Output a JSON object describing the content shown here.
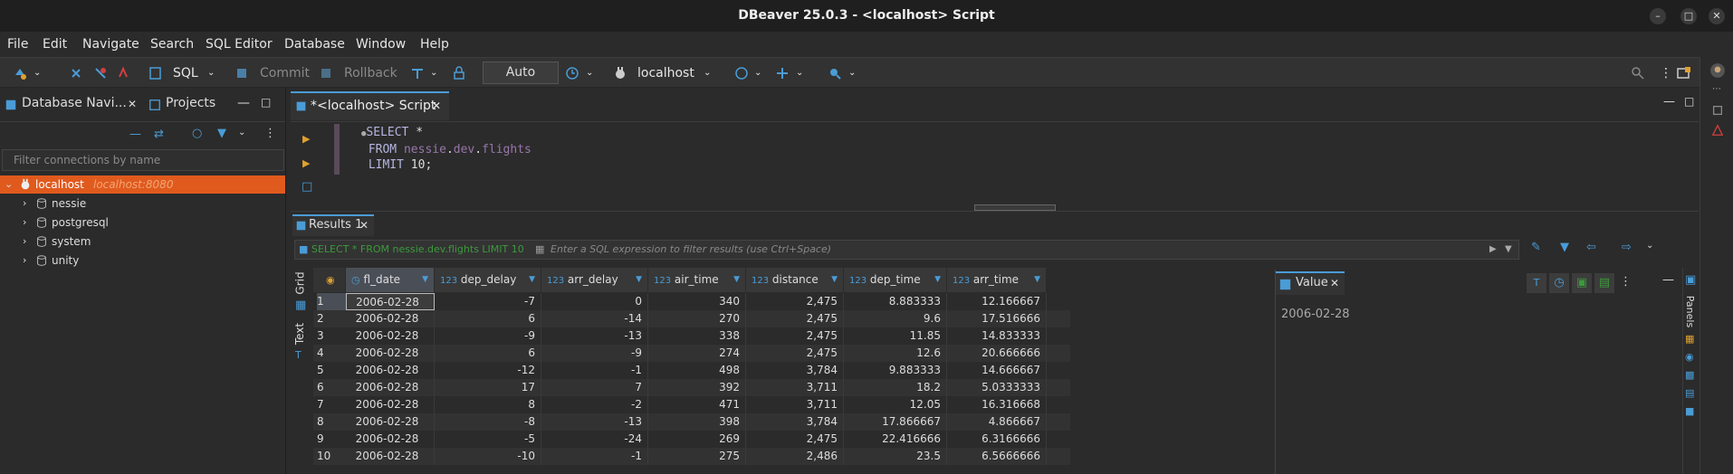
{
  "window": {
    "title": "DBeaver 25.0.3 - <localhost> Script"
  },
  "menu": [
    "File",
    "Edit",
    "Navigate",
    "Search",
    "SQL Editor",
    "Database",
    "Window",
    "Help"
  ],
  "toolbar": {
    "sql_label": "SQL",
    "commit_label": "Commit",
    "rollback_label": "Rollback",
    "auto_label": "Auto",
    "connection_label": "localhost"
  },
  "left_panel": {
    "tab_navigator": "Database Navi...",
    "tab_projects": "Projects",
    "filter_placeholder": "Filter connections by name",
    "tree": [
      {
        "label": "localhost",
        "extra": "localhost:8080"
      },
      {
        "label": "nessie"
      },
      {
        "label": "postgresql"
      },
      {
        "label": "system"
      },
      {
        "label": "unity"
      }
    ]
  },
  "editor": {
    "tab_label": "*<localhost> Script",
    "code": {
      "line1_kw": "SELECT",
      "line1_rest": " *",
      "line2_kw": "FROM",
      "line2_id1": "nessie",
      "line2_dot1": ".",
      "line2_id2": "dev",
      "line2_dot2": ".",
      "line2_id3": "flights",
      "line3_kw": "LIMIT",
      "line3_rest": " 10;"
    }
  },
  "results": {
    "tab_label": "Results 1",
    "query_text": "SELECT * FROM nessie.dev.flights LIMIT 10",
    "filter_placeholder": "Enter a SQL expression to filter results (use Ctrl+Space)",
    "side_grid": "Grid",
    "side_text": "Text",
    "columns": [
      "fl_date",
      "dep_delay",
      "arr_delay",
      "air_time",
      "distance",
      "dep_time",
      "arr_time"
    ],
    "type_prefix": "123",
    "rows": [
      [
        "2006-02-28",
        "-7",
        "0",
        "340",
        "2,475",
        "8.883333",
        "12.166667"
      ],
      [
        "2006-02-28",
        "6",
        "-14",
        "270",
        "2,475",
        "9.6",
        "17.516666"
      ],
      [
        "2006-02-28",
        "-9",
        "-13",
        "338",
        "2,475",
        "11.85",
        "14.833333"
      ],
      [
        "2006-02-28",
        "6",
        "-9",
        "274",
        "2,475",
        "12.6",
        "20.666666"
      ],
      [
        "2006-02-28",
        "-12",
        "-1",
        "498",
        "3,784",
        "9.883333",
        "14.666667"
      ],
      [
        "2006-02-28",
        "17",
        "7",
        "392",
        "3,711",
        "18.2",
        "5.0333333"
      ],
      [
        "2006-02-28",
        "8",
        "-2",
        "471",
        "3,711",
        "12.05",
        "16.316668"
      ],
      [
        "2006-02-28",
        "-8",
        "-13",
        "398",
        "3,784",
        "17.866667",
        "4.866667"
      ],
      [
        "2006-02-28",
        "-5",
        "-24",
        "269",
        "2,475",
        "22.416666",
        "6.3166666"
      ],
      [
        "2006-02-28",
        "-10",
        "-1",
        "275",
        "2,486",
        "23.5",
        "6.5666666"
      ]
    ],
    "row_numbers": [
      "1",
      "2",
      "3",
      "4",
      "5",
      "6",
      "7",
      "8",
      "9",
      "10"
    ]
  },
  "value_panel": {
    "tab_label": "Value",
    "value": "2006-02-28",
    "side_label": "Panels"
  },
  "colors": {
    "selection": "#e05a1e",
    "accent": "#4a9cd6"
  }
}
